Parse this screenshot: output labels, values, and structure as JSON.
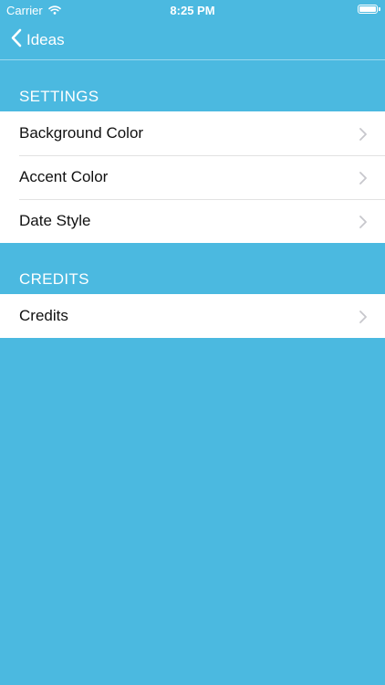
{
  "status_bar": {
    "carrier": "Carrier",
    "time": "8:25 PM"
  },
  "nav": {
    "back_label": "Ideas"
  },
  "sections": [
    {
      "header": "SETTINGS",
      "items": [
        {
          "label": "Background Color"
        },
        {
          "label": "Accent Color"
        },
        {
          "label": "Date Style"
        }
      ]
    },
    {
      "header": "CREDITS",
      "items": [
        {
          "label": "Credits"
        }
      ]
    }
  ],
  "colors": {
    "background": "#4bb9e0",
    "row_background": "#ffffff",
    "row_text": "#111111",
    "chevron": "#c7c7cc"
  }
}
